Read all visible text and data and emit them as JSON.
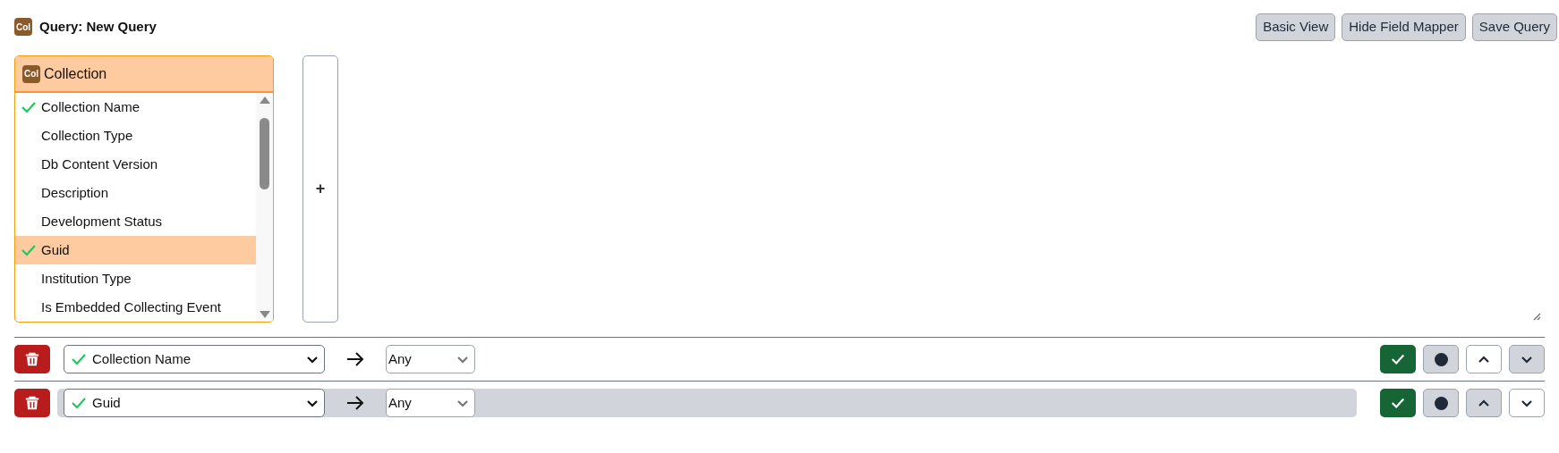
{
  "header": {
    "badge": "Col",
    "title": "Query: New Query",
    "buttons": [
      "Basic View",
      "Hide Field Mapper",
      "Save Query"
    ]
  },
  "table_panel": {
    "badge": "Col",
    "title": "Collection",
    "fields": [
      {
        "label": "Collection Name",
        "checked": true,
        "selected": false
      },
      {
        "label": "Collection Type",
        "checked": false,
        "selected": false
      },
      {
        "label": "Db Content Version",
        "checked": false,
        "selected": false
      },
      {
        "label": "Description",
        "checked": false,
        "selected": false
      },
      {
        "label": "Development Status",
        "checked": false,
        "selected": false
      },
      {
        "label": "Guid",
        "checked": true,
        "selected": true
      },
      {
        "label": "Institution Type",
        "checked": false,
        "selected": false
      },
      {
        "label": "Is Embedded Collecting Event",
        "checked": false,
        "selected": false
      }
    ]
  },
  "add_button": "+",
  "query_lines": [
    {
      "field": "Collection Name",
      "checked": true,
      "operator": "Any",
      "selected": false,
      "up_disabled": true,
      "down_disabled": false
    },
    {
      "field": "Guid",
      "checked": true,
      "operator": "Any",
      "selected": true,
      "up_disabled": false,
      "down_disabled": true
    }
  ]
}
